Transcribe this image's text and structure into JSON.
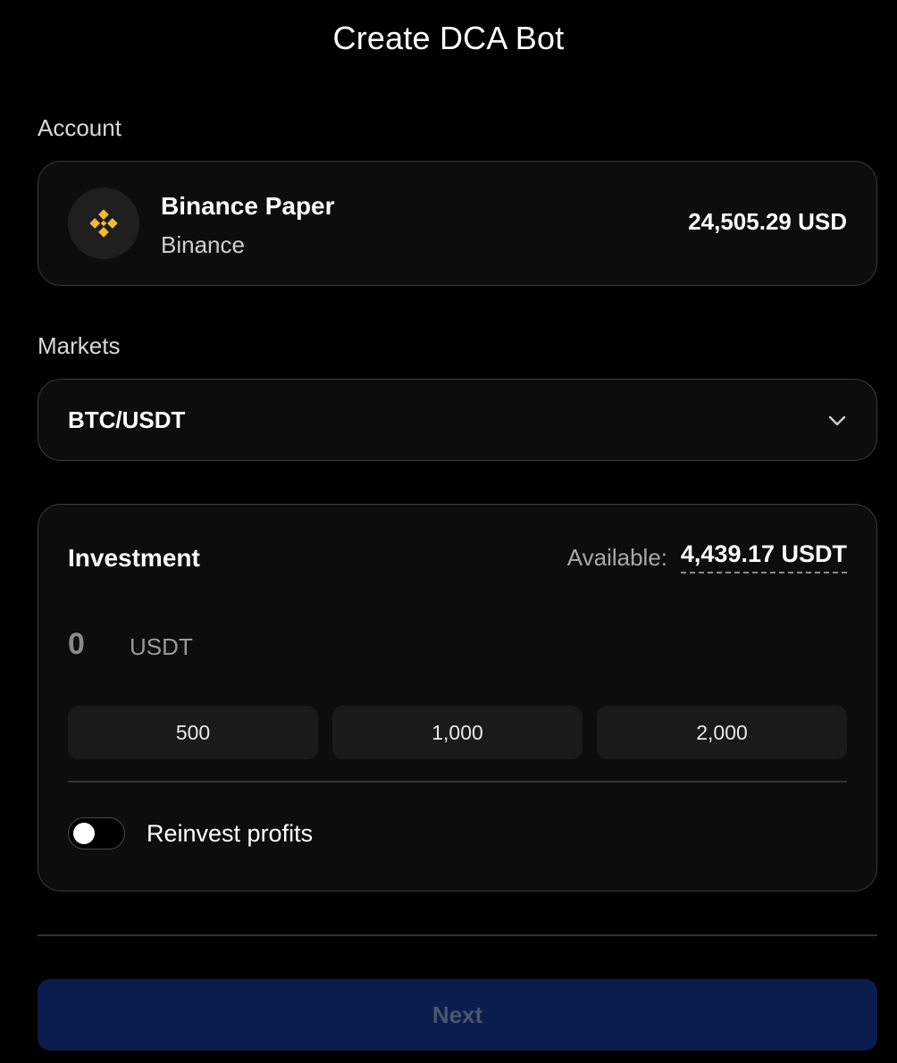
{
  "header": {
    "title": "Create DCA Bot"
  },
  "account": {
    "label": "Account",
    "name": "Binance Paper",
    "exchange": "Binance",
    "balance": "24,505.29 USD",
    "logo_icon": "binance-logo-icon",
    "brand_color": "#F3BA2F"
  },
  "markets": {
    "label": "Markets",
    "selected": "BTC/USDT",
    "icon": "chevron-down-icon"
  },
  "investment": {
    "title": "Investment",
    "available_label": "Available:",
    "available_value": "4,439.17 USDT",
    "amount_value": "0",
    "amount_placeholder": "0",
    "unit": "USDT",
    "presets": [
      "500",
      "1,000",
      "2,000"
    ],
    "reinvest_label": "Reinvest profits",
    "reinvest_on": false
  },
  "footer": {
    "next_label": "Next",
    "next_color": "#0B1D4D"
  }
}
